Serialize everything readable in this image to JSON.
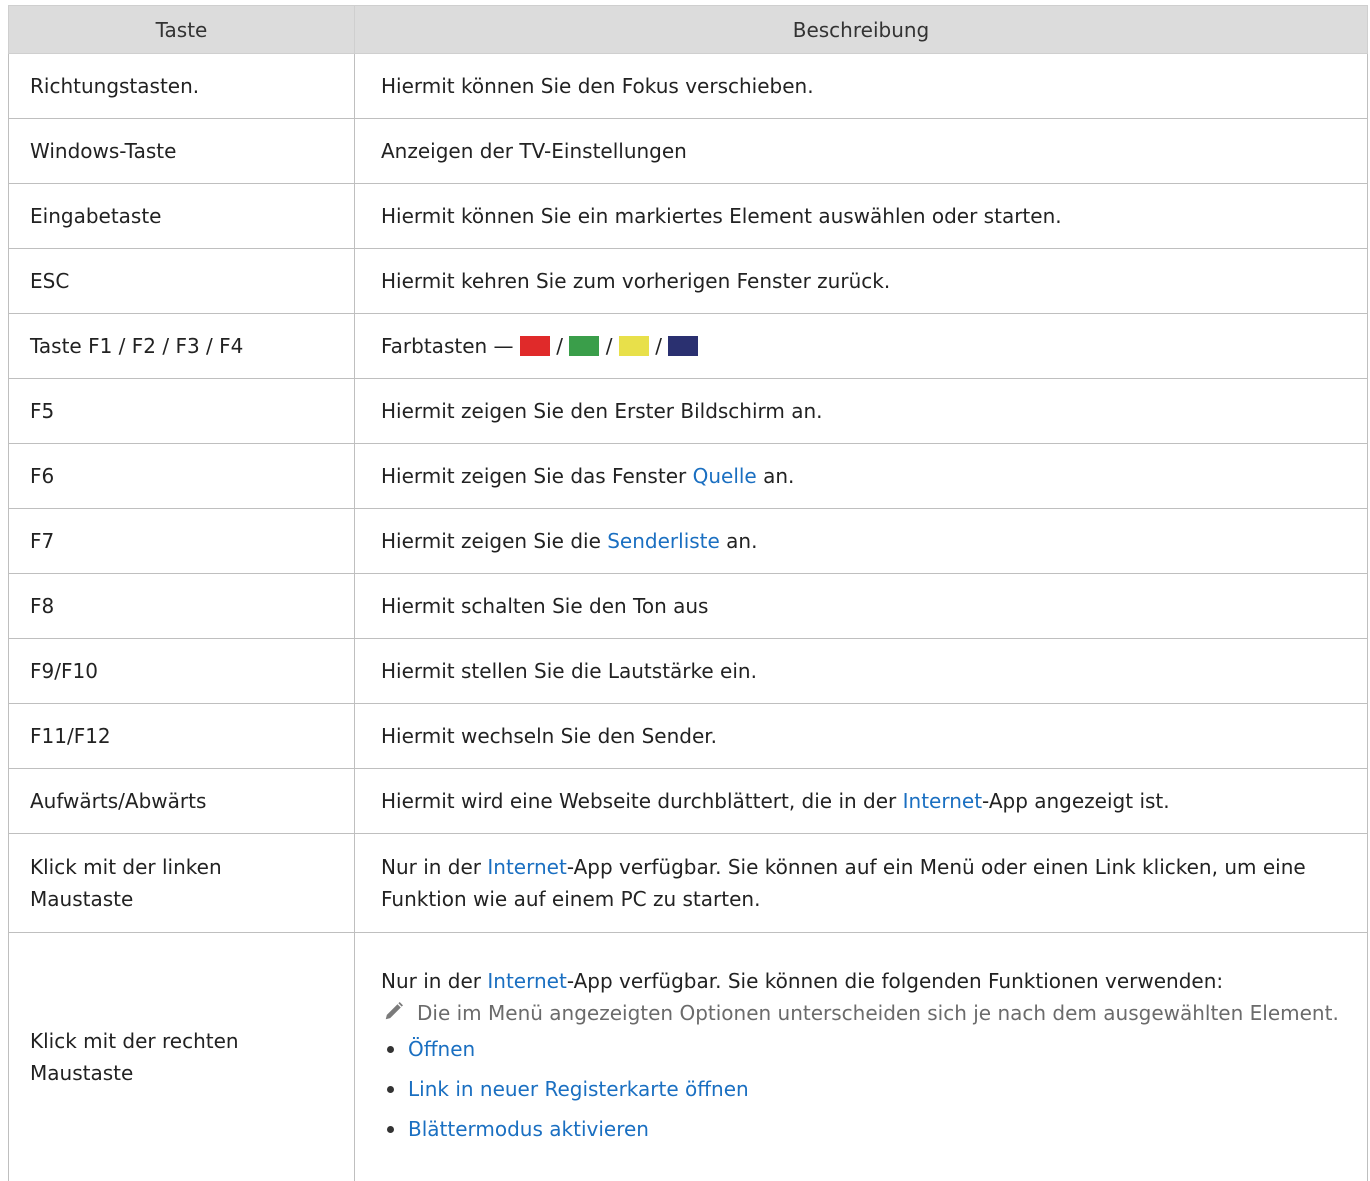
{
  "header": {
    "col_key": "Taste",
    "col_desc": "Beschreibung"
  },
  "rows": [
    {
      "key": "Richtungstasten.",
      "desc": "Hiermit können Sie den Fokus verschieben."
    },
    {
      "key": "Windows-Taste",
      "desc": "Anzeigen der TV-Einstellungen"
    },
    {
      "key": "Eingabetaste",
      "desc": "Hiermit können Sie ein markiertes Element auswählen oder starten."
    },
    {
      "key": "ESC",
      "desc": "Hiermit kehren Sie zum vorherigen Fenster zurück."
    },
    {
      "key": "Taste F1 / F2 / F3 / F4",
      "desc_prefix": "Farbtasten — ",
      "sep": "/",
      "colors": {
        "red": "#e02a2a",
        "green": "#3a9e4a",
        "yellow": "#e8e04a",
        "blue": "#2a3070"
      }
    },
    {
      "key": "F5",
      "desc": "Hiermit zeigen Sie den Erster Bildschirm an."
    },
    {
      "key": "F6",
      "desc_before": "Hiermit zeigen Sie das Fenster ",
      "desc_link": "Quelle",
      "desc_after": " an."
    },
    {
      "key": "F7",
      "desc_before": "Hiermit zeigen Sie die ",
      "desc_link": "Senderliste",
      "desc_after": " an."
    },
    {
      "key": "F8",
      "desc": "Hiermit schalten Sie den Ton aus"
    },
    {
      "key": "F9/F10",
      "desc": "Hiermit stellen Sie die Lautstärke ein."
    },
    {
      "key": "F11/F12",
      "desc": "Hiermit wechseln Sie den Sender."
    },
    {
      "key": "Aufwärts/Abwärts",
      "desc_before": "Hiermit wird eine Webseite durchblättert, die in der ",
      "desc_link": "Internet",
      "desc_after": "-App angezeigt ist."
    },
    {
      "key_line1": "Klick mit der linken",
      "key_line2": "Maustaste",
      "desc_before": "Nur in der ",
      "desc_link": "Internet",
      "desc_after": "-App verfügbar. Sie können auf ein Menü oder einen Link klicken, um eine Funktion wie auf einem PC zu starten."
    },
    {
      "key_line1": "Klick mit der rechten",
      "key_line2": "Maustaste",
      "desc_before": "Nur in der ",
      "desc_link": "Internet",
      "desc_after": "-App verfügbar. Sie können die folgenden Funktionen verwenden:",
      "note_icon": "pencil-icon",
      "note": "Die im Menü angezeigten Optionen unterscheiden sich je nach dem ausgewählten Element.",
      "options": [
        "Öffnen",
        "Link in neuer Registerkarte öffnen",
        "Blättermodus aktivieren"
      ]
    }
  ]
}
